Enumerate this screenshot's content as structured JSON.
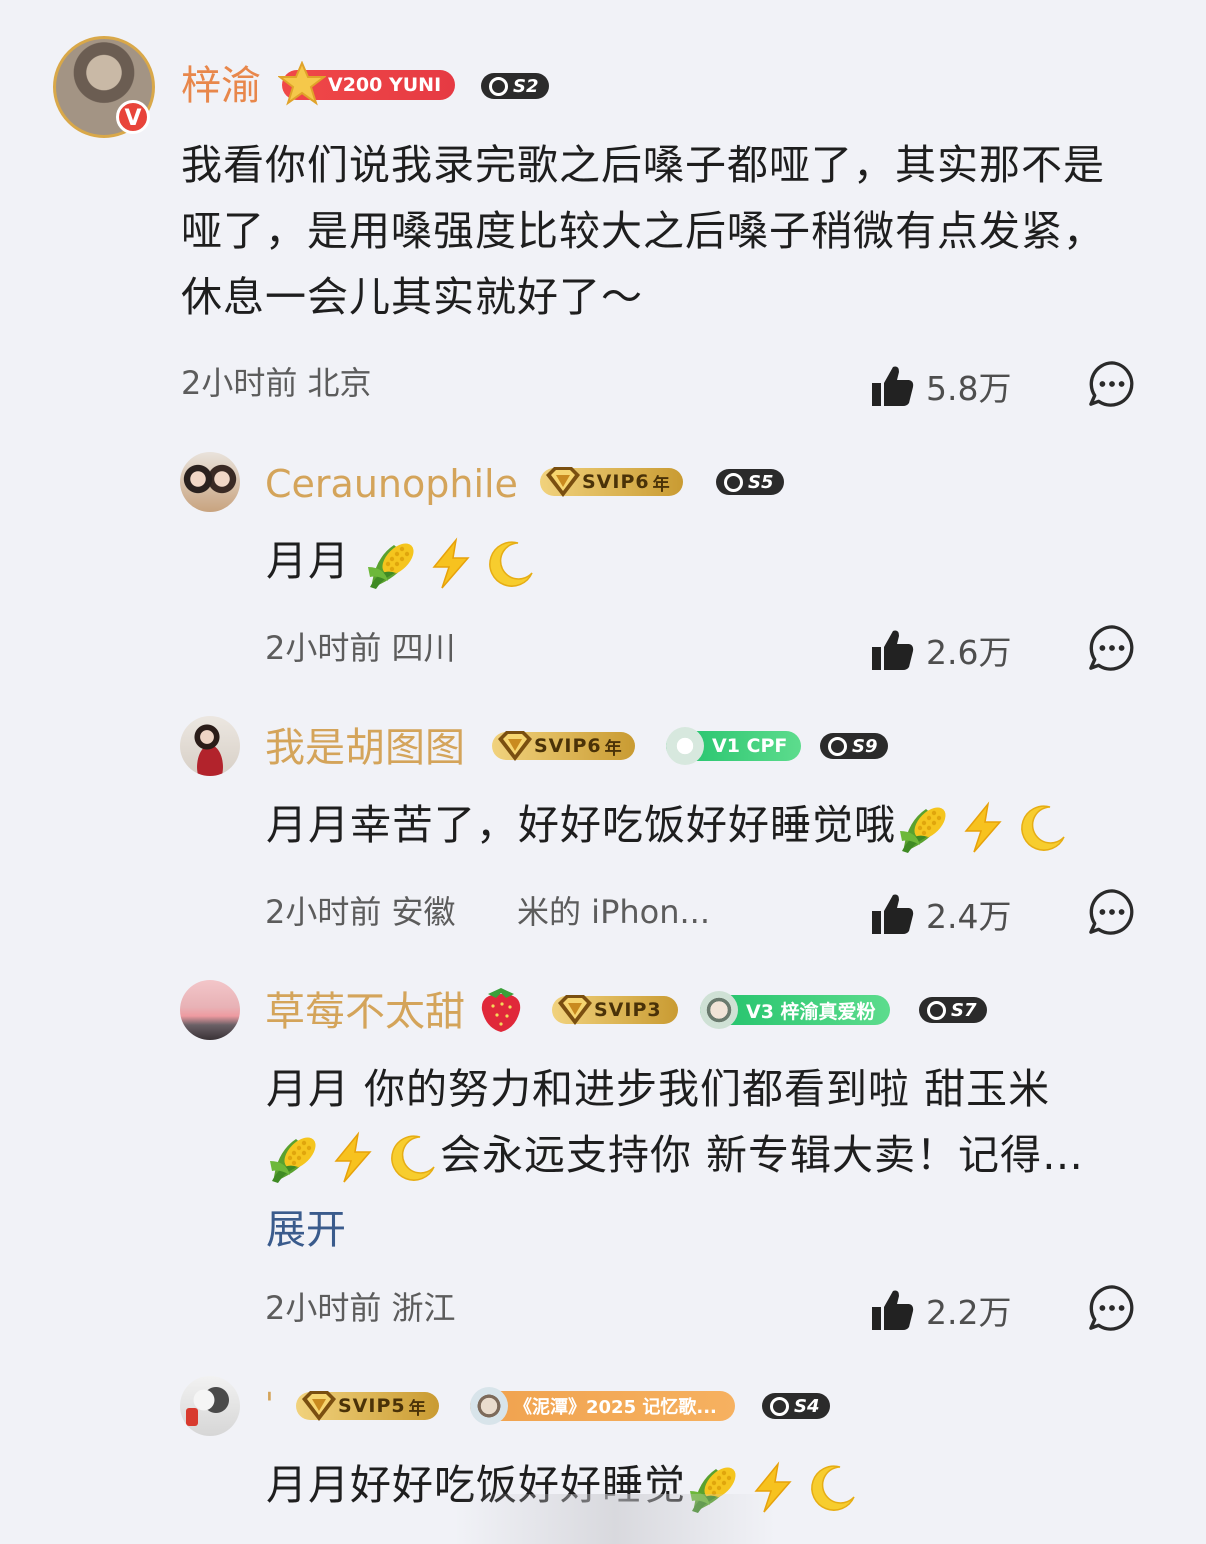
{
  "colors": {
    "background": "#f1f2f7",
    "main_user": "#e8874b",
    "gold_user": "#d4a45a",
    "link": "#3a5b8c"
  },
  "comments": [
    {
      "user": "梓渝",
      "badges": {
        "level": "V200 YUNI",
        "season": "S2"
      },
      "text": "我看你们说我录完歌之后嗓子都哑了，其实那不是哑了，是用嗓强度比较大之后嗓子稍微有点发紧，休息一会儿其实就好了～",
      "time": "2小时前",
      "location": "北京",
      "likes": "5.8万"
    },
    {
      "user": "Ceraunophile",
      "badges": {
        "vip": "SVIP6",
        "vip_suffix": "年",
        "season": "S5"
      },
      "text": "月月",
      "emojis": [
        "corn-emoji",
        "lightning-emoji",
        "moon-emoji"
      ],
      "time": "2小时前",
      "location": "四川",
      "likes": "2.6万"
    },
    {
      "user": "我是胡图图",
      "badges": {
        "vip": "SVIP6",
        "vip_suffix": "年",
        "fan": "V1 CPF",
        "season": "S9"
      },
      "text": "月月幸苦了，好好吃饭好好睡觉哦",
      "emojis": [
        "corn-emoji",
        "lightning-emoji",
        "moon-emoji"
      ],
      "time": "2小时前",
      "location": "安徽",
      "device": "米的 iPhon...",
      "likes": "2.4万"
    },
    {
      "user": "草莓不太甜",
      "badges": {
        "vip": "SVIP3",
        "fan": "V3 梓渝真爱粉",
        "season": "S7"
      },
      "text_line1": "月月 你的努力和进步我们都看到啦 甜玉米",
      "text_line2": "会永远支持你 新专辑大卖！记得…",
      "expand": "展开",
      "time": "2小时前",
      "location": "浙江",
      "likes": "2.2万"
    },
    {
      "user": "'",
      "badges": {
        "vip": "SVIP5",
        "vip_suffix": "年",
        "event": "《泥潭》2025 记忆歌...",
        "season": "S4"
      },
      "text": "月月好好吃饭好好睡觉"
    }
  ]
}
